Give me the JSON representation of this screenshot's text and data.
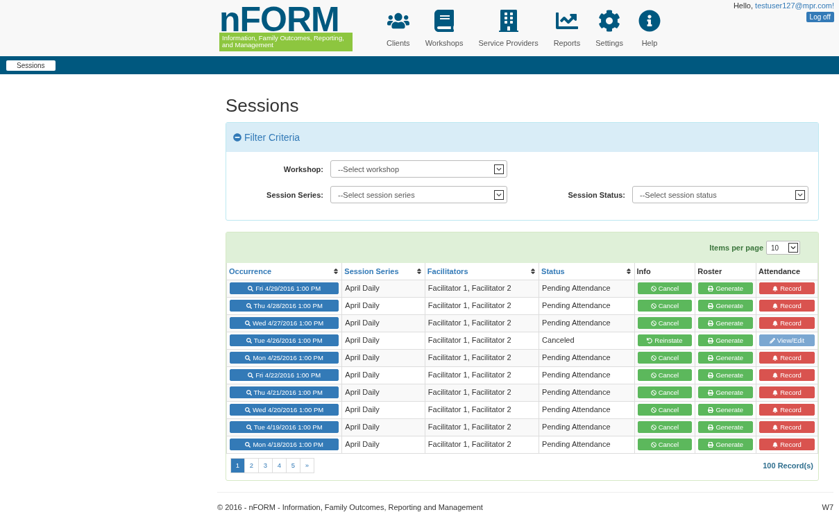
{
  "logo": {
    "title": "nFORM",
    "subtitle": "Information, Family Outcomes, Reporting, and Management"
  },
  "nav": [
    {
      "label": "Clients"
    },
    {
      "label": "Workshops"
    },
    {
      "label": "Service Providers"
    },
    {
      "label": "Reports"
    },
    {
      "label": "Settings"
    },
    {
      "label": "Help"
    }
  ],
  "user": {
    "greeting": "Hello,",
    "email": "testuser127@mpr.com!",
    "logoff": "Log off"
  },
  "breadcrumb": {
    "label": "Sessions"
  },
  "page_title": "Sessions",
  "filter": {
    "title": "Filter Criteria",
    "expanded": true,
    "fields": [
      {
        "label": "Workshop:",
        "placeholder": "--Select workshop"
      },
      {
        "label": "Session Series:",
        "placeholder": "--Select session series"
      },
      {
        "label": "Session Status:",
        "placeholder": "--Select session status"
      }
    ]
  },
  "items_per_page": {
    "label": "Items per page",
    "value": "10"
  },
  "table": {
    "columns": [
      {
        "label": "Occurrence",
        "sortable": true
      },
      {
        "label": "Session Series",
        "sortable": true
      },
      {
        "label": "Facilitators",
        "sortable": true
      },
      {
        "label": "Status",
        "sortable": true
      },
      {
        "label": "Info",
        "sortable": false
      },
      {
        "label": "Roster",
        "sortable": false
      },
      {
        "label": "Attendance",
        "sortable": false
      }
    ],
    "rows": [
      {
        "kind": "pending",
        "occurrence": "Fri 4/29/2016 1:00 PM",
        "series": "April Daily",
        "facilitators": "Facilitator 1, Facilitator 2",
        "status": "Pending Attendance",
        "info": "Cancel",
        "roster": "Generate",
        "attendance": "Record"
      },
      {
        "kind": "pending",
        "occurrence": "Thu 4/28/2016 1:00 PM",
        "series": "April Daily",
        "facilitators": "Facilitator 1, Facilitator 2",
        "status": "Pending Attendance",
        "info": "Cancel",
        "roster": "Generate",
        "attendance": "Record"
      },
      {
        "kind": "pending",
        "occurrence": "Wed 4/27/2016 1:00 PM",
        "series": "April Daily",
        "facilitators": "Facilitator 1, Facilitator 2",
        "status": "Pending Attendance",
        "info": "Cancel",
        "roster": "Generate",
        "attendance": "Record"
      },
      {
        "kind": "canceled",
        "occurrence": "Tue 4/26/2016 1:00 PM",
        "series": "April Daily",
        "facilitators": "Facilitator 1, Facilitator 2",
        "status": "Canceled",
        "info": "Reinstate",
        "roster": "Generate",
        "attendance": "View/Edit"
      },
      {
        "kind": "pending",
        "occurrence": "Mon 4/25/2016 1:00 PM",
        "series": "April Daily",
        "facilitators": "Facilitator 1, Facilitator 2",
        "status": "Pending Attendance",
        "info": "Cancel",
        "roster": "Generate",
        "attendance": "Record"
      },
      {
        "kind": "pending",
        "occurrence": "Fri 4/22/2016 1:00 PM",
        "series": "April Daily",
        "facilitators": "Facilitator 1, Facilitator 2",
        "status": "Pending Attendance",
        "info": "Cancel",
        "roster": "Generate",
        "attendance": "Record"
      },
      {
        "kind": "pending",
        "occurrence": "Thu 4/21/2016 1:00 PM",
        "series": "April Daily",
        "facilitators": "Facilitator 1, Facilitator 2",
        "status": "Pending Attendance",
        "info": "Cancel",
        "roster": "Generate",
        "attendance": "Record"
      },
      {
        "kind": "pending",
        "occurrence": "Wed 4/20/2016 1:00 PM",
        "series": "April Daily",
        "facilitators": "Facilitator 1, Facilitator 2",
        "status": "Pending Attendance",
        "info": "Cancel",
        "roster": "Generate",
        "attendance": "Record"
      },
      {
        "kind": "pending",
        "occurrence": "Tue 4/19/2016 1:00 PM",
        "series": "April Daily",
        "facilitators": "Facilitator 1, Facilitator 2",
        "status": "Pending Attendance",
        "info": "Cancel",
        "roster": "Generate",
        "attendance": "Record"
      },
      {
        "kind": "pending",
        "occurrence": "Mon 4/18/2016 1:00 PM",
        "series": "April Daily",
        "facilitators": "Facilitator 1, Facilitator 2",
        "status": "Pending Attendance",
        "info": "Cancel",
        "roster": "Generate",
        "attendance": "Record"
      }
    ]
  },
  "pagination": [
    {
      "label": "1",
      "selected": true
    },
    {
      "label": "2",
      "selected": false
    },
    {
      "label": "3",
      "selected": false
    },
    {
      "label": "4",
      "selected": false
    },
    {
      "label": "5",
      "selected": false
    },
    {
      "label": "»",
      "selected": false
    }
  ],
  "record_count": "100 Record(s)",
  "footer": {
    "copyright": "© 2016 - nFORM - Information, Family Outcomes, Reporting and Management",
    "version": "W7"
  }
}
